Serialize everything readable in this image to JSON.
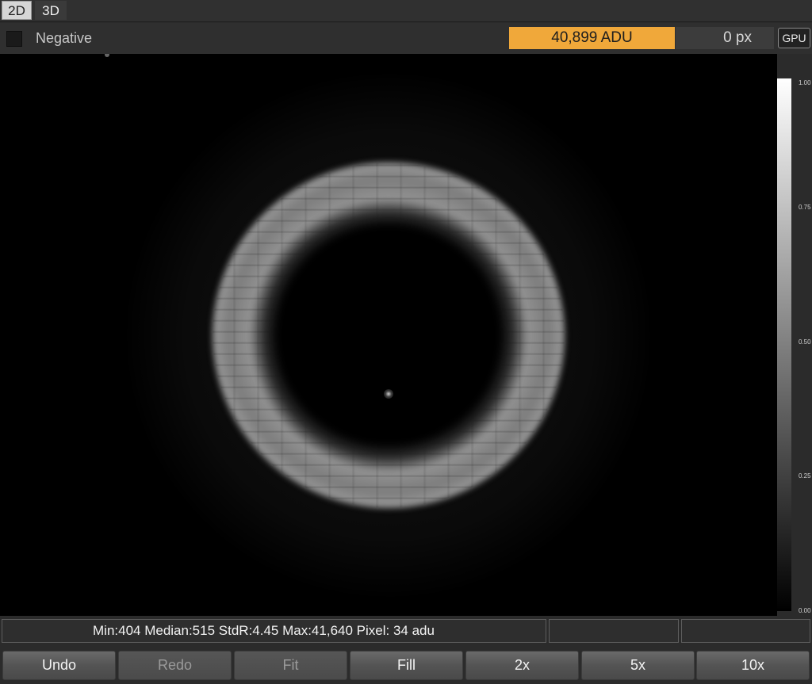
{
  "tabs": [
    {
      "label": "2D",
      "active": true
    },
    {
      "label": "3D",
      "active": false
    }
  ],
  "toolbar": {
    "negative_label": "Negative",
    "negative_checked": false,
    "adu_value": "40,899 ADU",
    "px_value": "0 px",
    "gpu_label": "GPU"
  },
  "colorbar": {
    "ticks": [
      "1.00",
      "0.75",
      "0.50",
      "0.25",
      "0.00"
    ]
  },
  "status": {
    "stats_text": "Min:404 Median:515 StdR:4.45 Max:41,640 Pixel: 34 adu",
    "cell2": "",
    "cell3": ""
  },
  "buttons": [
    {
      "label": "Undo",
      "enabled": true
    },
    {
      "label": "Redo",
      "enabled": false
    },
    {
      "label": "Fit",
      "enabled": false
    },
    {
      "label": "Fill",
      "enabled": true
    },
    {
      "label": "2x",
      "enabled": true
    },
    {
      "label": "5x",
      "enabled": true
    },
    {
      "label": "10x",
      "enabled": true
    }
  ],
  "colors": {
    "adu_highlight": "#f0a83a",
    "background": "#2b2b2b"
  }
}
